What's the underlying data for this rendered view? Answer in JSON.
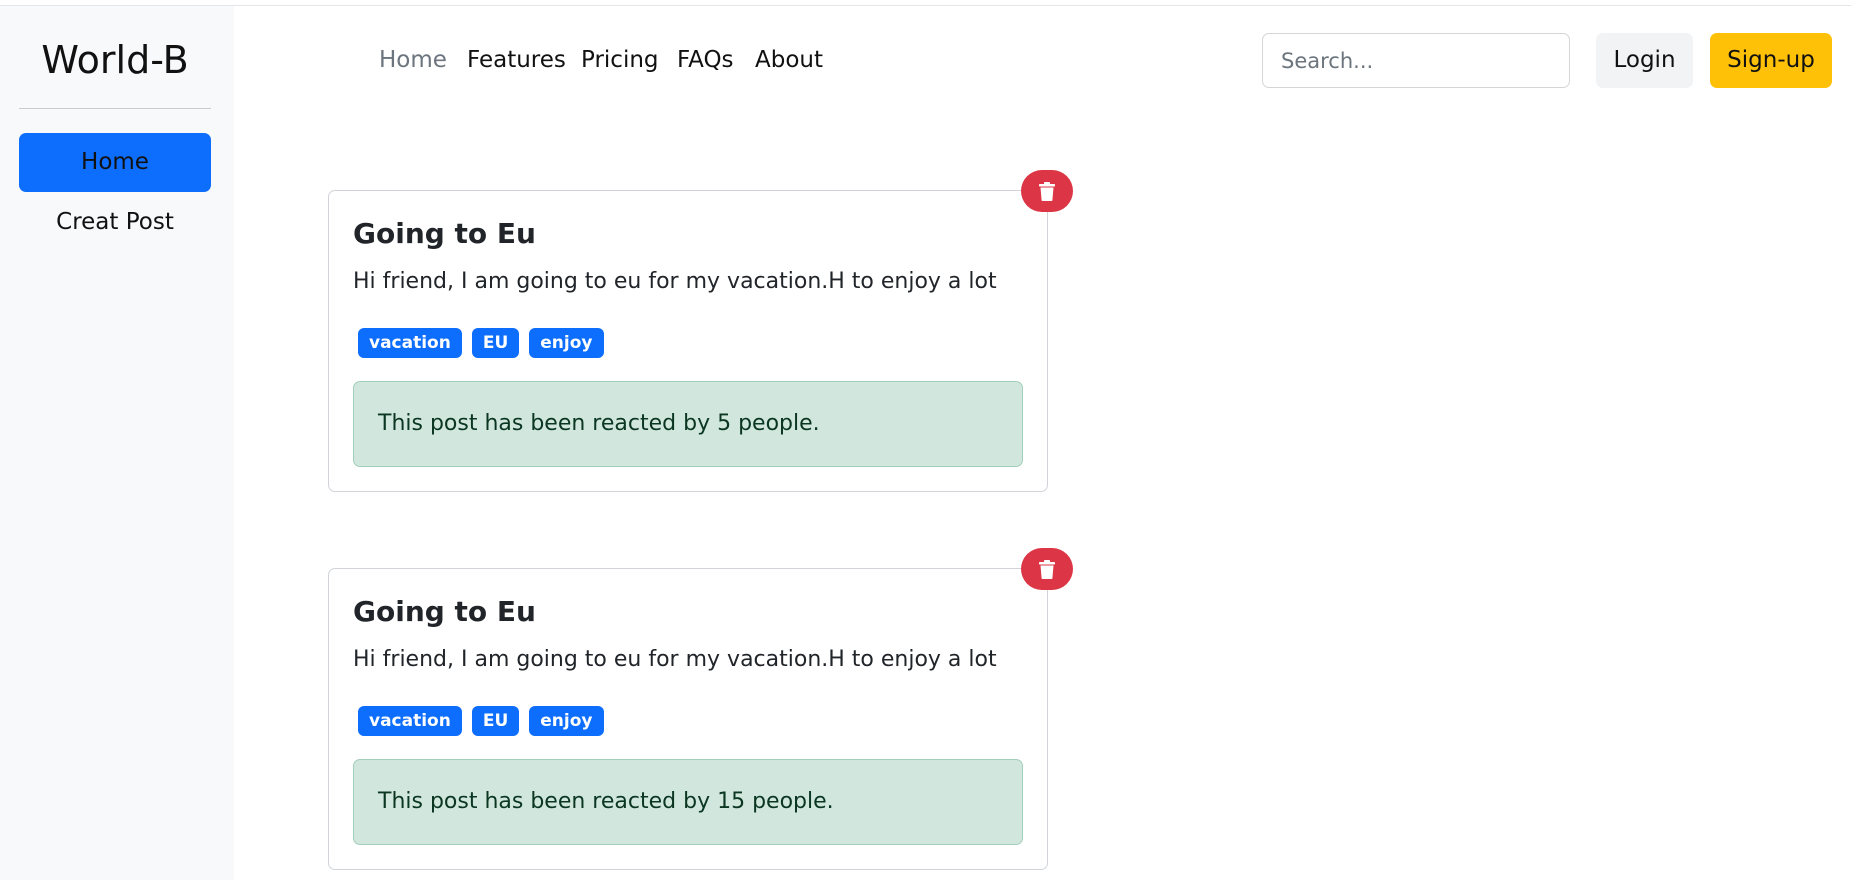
{
  "sidebar": {
    "brand": "World-B",
    "items": [
      {
        "label": "Home",
        "active": true
      },
      {
        "label": "Creat Post",
        "active": false
      }
    ]
  },
  "nav": {
    "links": [
      "Home",
      "Features",
      "Pricing",
      "FAQs",
      "About"
    ],
    "search_placeholder": "Search...",
    "login_label": "Login",
    "signup_label": "Sign-up"
  },
  "posts": [
    {
      "title": "Going to Eu",
      "body": "Hi friend, I am going to eu for my vacation.H to enjoy a lot",
      "tags": [
        "vacation",
        "EU",
        "enjoy"
      ],
      "reactions_text": "This post has been reacted by 5 people.",
      "delete_icon": "trash-icon"
    },
    {
      "title": "Going to Eu",
      "body": "Hi friend, I am going to eu for my vacation.H to enjoy a lot",
      "tags": [
        "vacation",
        "EU",
        "enjoy"
      ],
      "reactions_text": "This post has been reacted by 15 people.",
      "delete_icon": "trash-icon"
    }
  ],
  "colors": {
    "primary": "#0d6efd",
    "warning": "#ffc107",
    "danger": "#dc3545",
    "success_bg": "#d1e7dd",
    "sidebar_bg": "#f8f9fa"
  }
}
